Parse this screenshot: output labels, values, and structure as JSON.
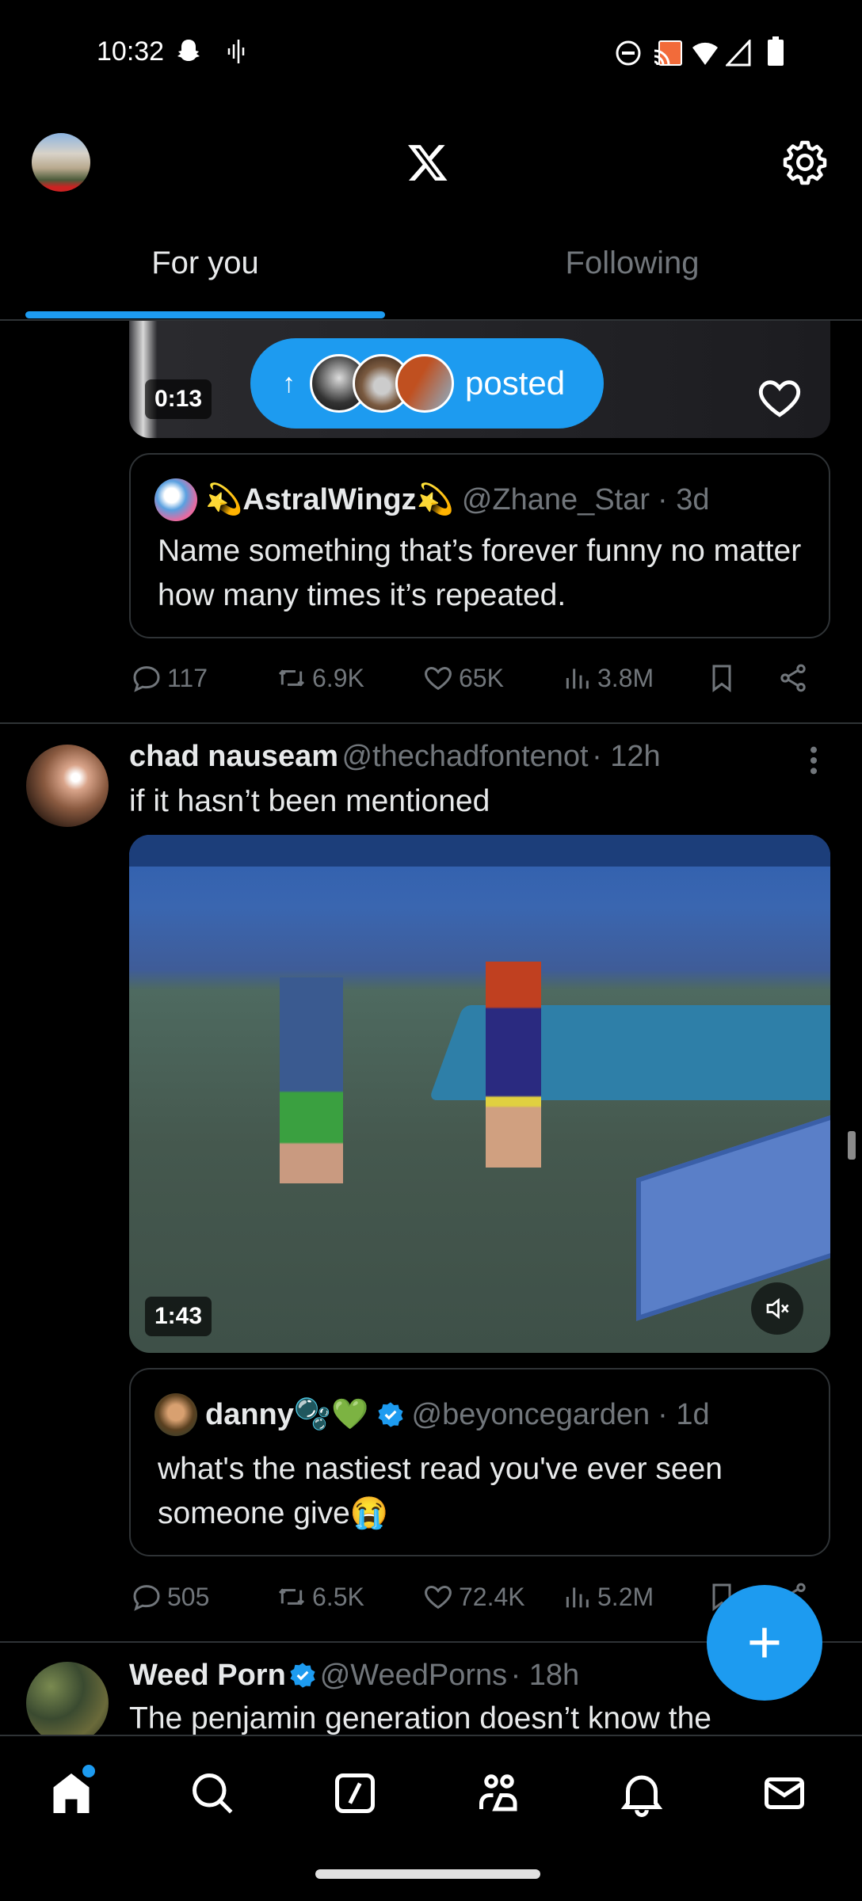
{
  "status_bar": {
    "time": "10:32",
    "left_icons": [
      "snapchat-icon",
      "audio-wave-icon"
    ],
    "right_icons": [
      "dnd-icon",
      "cast-icon",
      "wifi-icon",
      "signal-icon",
      "battery-icon"
    ]
  },
  "header": {
    "logo": "X",
    "settings_icon": "gear-icon"
  },
  "tabs": [
    {
      "label": "For you",
      "active": true
    },
    {
      "label": "Following",
      "active": false
    }
  ],
  "accent": "#1d9bf0",
  "posted_pill": {
    "label": "posted",
    "arrow": "↑"
  },
  "tweet1": {
    "video_duration": "0:13",
    "quote": {
      "name": "💫AstralWingz💫",
      "handle": "@Zhane_Star",
      "time": "· 3d",
      "text": "Name something that’s forever funny no matter how many times it’s repeated."
    },
    "actions": {
      "replies": "117",
      "reposts": "6.9K",
      "likes": "65K",
      "views": "3.8M"
    }
  },
  "tweet2": {
    "name": "chad nauseam",
    "handle": "@thechadfontenot",
    "time": "· 12h",
    "text": "if it hasn’t been mentioned",
    "video_duration": "1:43",
    "quote": {
      "name": "danny🫧💚",
      "handle": "@beyoncegarden",
      "time": "· 1d",
      "text": "what's the nastiest read you've ever seen someone give😭",
      "verified": true
    },
    "actions": {
      "replies": "505",
      "reposts": "6.5K",
      "likes": "72.4K",
      "views": "5.2M"
    }
  },
  "tweet3": {
    "name": "Weed Porn",
    "handle": "@WeedPorns",
    "time": "· 18h",
    "text": "The penjamin generation doesn’t know the",
    "verified": true
  },
  "fab": {
    "icon": "plus-icon",
    "label": "+"
  },
  "bottom_nav": [
    {
      "name": "home",
      "active": true,
      "badge_dot": true
    },
    {
      "name": "search"
    },
    {
      "name": "grok"
    },
    {
      "name": "communities"
    },
    {
      "name": "notifications"
    },
    {
      "name": "messages"
    }
  ]
}
